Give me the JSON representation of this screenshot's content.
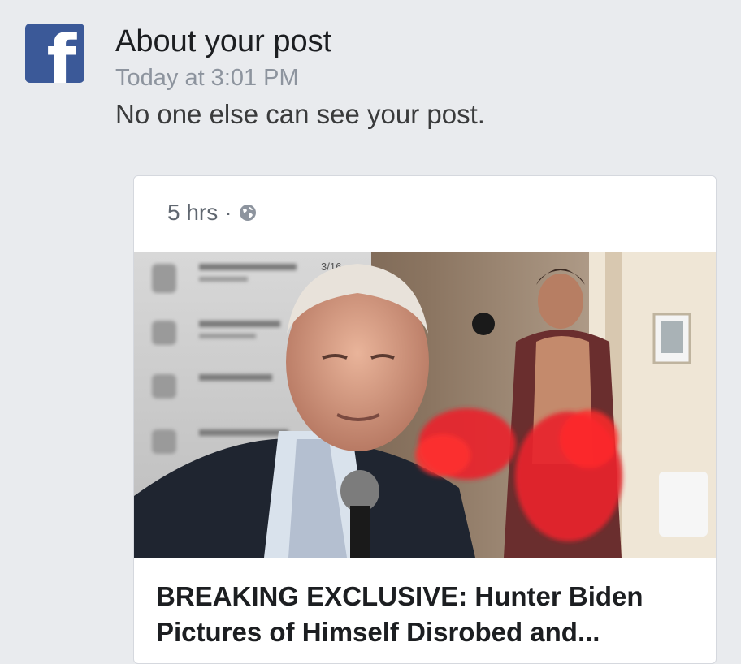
{
  "notification": {
    "title": "About your post",
    "time": "Today at 3:01 PM",
    "message": "No one else can see your post."
  },
  "post": {
    "age": "5 hrs",
    "separator": "·",
    "visibility_icon": "globe-icon",
    "image_caption_text": "3/16",
    "headline": "BREAKING EXCLUSIVE: Hunter Biden Pictures of Himself Disrobed and..."
  },
  "colors": {
    "facebook_blue": "#3b5998",
    "background": "#e9ebee",
    "censor_red": "#e8222b"
  }
}
